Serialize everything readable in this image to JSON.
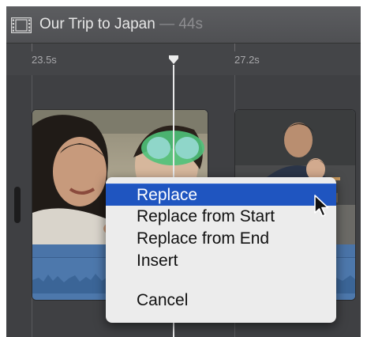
{
  "project": {
    "title": "Our Trip to Japan",
    "separator": "—",
    "duration": "44s"
  },
  "ruler": {
    "marker_left": "23.5s",
    "marker_right": "27.2s"
  },
  "context_menu": {
    "items": [
      {
        "label": "Replace",
        "selected": true
      },
      {
        "label": "Replace from Start",
        "selected": false
      },
      {
        "label": "Replace from End",
        "selected": false
      },
      {
        "label": "Insert",
        "selected": false
      },
      {
        "label": "Cancel",
        "selected": false
      }
    ]
  },
  "colors": {
    "timeline_bg": "#3f4043",
    "menu_highlight": "#1f55c0",
    "audio_track": "#4d78ac"
  },
  "icons": [
    "film-strip-icon",
    "playhead-icon",
    "pointer-cursor-icon"
  ]
}
